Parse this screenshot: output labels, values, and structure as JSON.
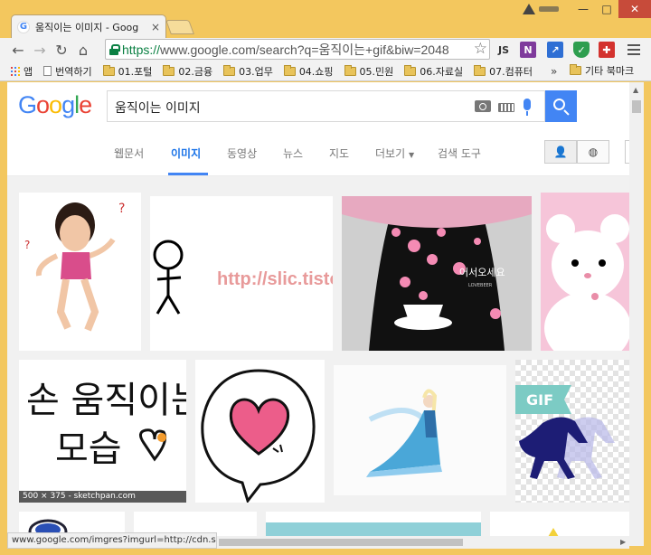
{
  "browser": {
    "tab_title": "움직이는 이미지 - Goog",
    "tab_favicon": "G",
    "tab_close": "×",
    "window": {
      "minimize": "—",
      "maximize": "□",
      "close": "✕"
    },
    "nav": {
      "back": "←",
      "forward": "→",
      "reload": "↻",
      "home": "⌂"
    },
    "url_scheme": "https://",
    "url_rest": "www.google.com/search?q=움직이는+gif&biw=2048",
    "star": "☆",
    "extensions": {
      "js": "JS",
      "onenote": "N",
      "chart": "↗",
      "shield": "✓",
      "puzzle": "✚"
    }
  },
  "bookmarks": {
    "items": [
      {
        "label": "앱",
        "icon": "apps-icon"
      },
      {
        "label": "번역하기",
        "icon": "page-icon"
      },
      {
        "label": "01.포털",
        "icon": "folder-icon"
      },
      {
        "label": "02.금융",
        "icon": "folder-icon"
      },
      {
        "label": "03.업무",
        "icon": "folder-icon"
      },
      {
        "label": "04.쇼핑",
        "icon": "folder-icon"
      },
      {
        "label": "05.민원",
        "icon": "folder-icon"
      },
      {
        "label": "06.자료실",
        "icon": "folder-icon"
      },
      {
        "label": "07.컴퓨터",
        "icon": "folder-icon"
      }
    ],
    "more": "»",
    "other": "기타 북마크"
  },
  "google": {
    "logo": [
      "G",
      "o",
      "o",
      "g",
      "l",
      "e"
    ],
    "query": "움직이는 이미지",
    "tabs": [
      "웹문서",
      "이미지",
      "동영상",
      "뉴스",
      "지도",
      "더보기",
      "검색 도구"
    ],
    "more_caret": "▼",
    "safe_search_icons": [
      "person-icon",
      "globe-icon"
    ],
    "safe_person": "👤",
    "safe_globe": "◍"
  },
  "results": {
    "watermark": "http://slic.tistory.com",
    "welcome_text": "어서오세요",
    "welcome_sub": "LOVEBEER",
    "handwriting_line1": "손 움직이는",
    "handwriting_line2": "모습",
    "caption": "500 × 375 - sketchpan.com",
    "gif_label": "GIF"
  },
  "status": {
    "url": "www.google.com/imgres?imgurl=http://cdn.sk..."
  },
  "colors": {
    "window_frame": "#f3c75e",
    "google_blue": "#4285f4",
    "active_tab": "#1a73e8",
    "secure_green": "#0b8043"
  }
}
